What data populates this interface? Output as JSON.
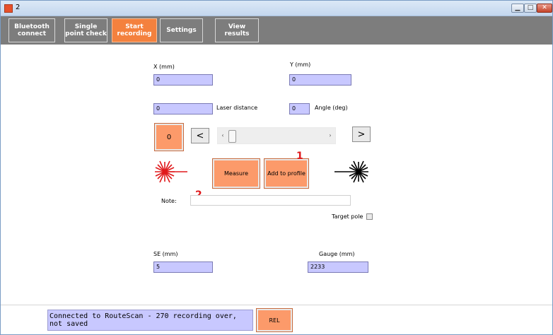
{
  "window": {
    "title": "2"
  },
  "toolbar": {
    "bluetooth": "Bluetooth connect",
    "single_point": "Single point check",
    "start_recording": "Start recording",
    "settings": "Settings",
    "view_results": "View results",
    "active": "start_recording"
  },
  "form": {
    "x_label": "X (mm)",
    "x_value": "0",
    "y_label": "Y (mm)",
    "y_value": "0",
    "laser_value": "0",
    "laser_label": "Laser distance",
    "angle_value": "0",
    "angle_label": "Angle (deg)",
    "counter_value": "0",
    "prev_label": "<",
    "next_label": ">",
    "measure_label": "Measure",
    "add_profile_label": "Add to profile",
    "marker_1": "1",
    "marker_2": "2",
    "note_label": "Note:",
    "note_value": "",
    "target_pole_label": "Target pole",
    "target_pole_checked": false,
    "se_label": "SE (mm)",
    "se_value": "5",
    "gauge_label": "Gauge (mm)",
    "gauge_value": "2233"
  },
  "status": {
    "message": "Connected to RouteScan - 270  recording over, not saved",
    "rel_label": "REL"
  },
  "colors": {
    "accent": "#f4813e",
    "button_orange": "#fc9a6a",
    "field_bg": "#c8c8ff",
    "toolbar_bg": "#7d7d7d",
    "laser_red": "#e0191b",
    "laser_black": "#000000"
  },
  "icons": {
    "laser_red": "laser-burst-red-icon",
    "laser_black": "laser-burst-black-icon"
  }
}
